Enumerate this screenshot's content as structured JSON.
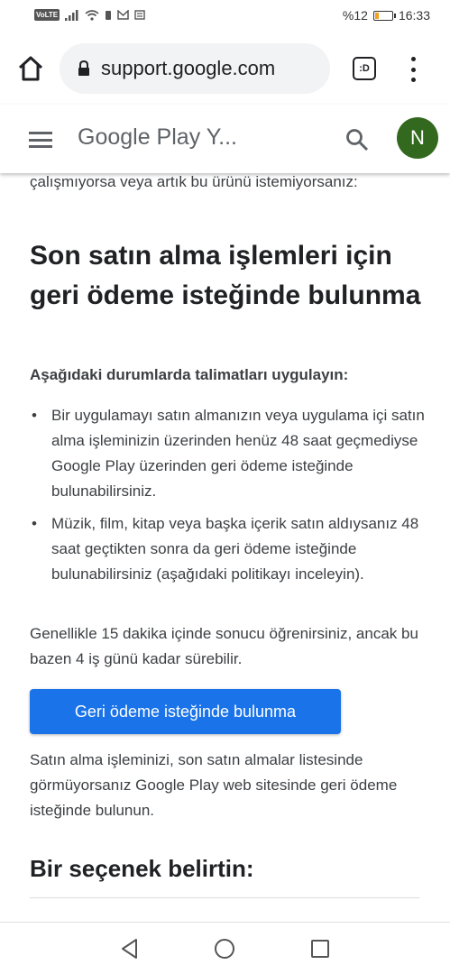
{
  "status_bar": {
    "volte": "VoLTE",
    "battery_text": "%12",
    "battery_level": 0.12,
    "time": "16:33"
  },
  "browser": {
    "url": "support.google.com",
    "tabs_label": ":D"
  },
  "site_header": {
    "title": "Google Play Y...",
    "avatar_initial": "N",
    "avatar_color": "#33691e"
  },
  "content": {
    "cut_line": "çalışmıyorsa veya artık bu ürünü istemiyorsanız:",
    "heading": "Son satın alma işlemleri için geri ödeme isteğinde bulunma",
    "subheading": "Aşağıdaki durumlarda talimatları uygulayın:",
    "bullets": [
      "Bir uygulamayı satın almanızın veya uygulama içi satın alma işleminizin üzerinden henüz 48 saat geçmediyse Google Play üzerinden geri ödeme isteğinde bulunabilirsiniz.",
      "Müzik, film, kitap veya başka içerik satın aldıysanız 48 saat geçtikten sonra da geri ödeme isteğinde bulunabilirsiniz (aşağıdaki politikayı inceleyin)."
    ],
    "paragraph_1": "Genellikle 15 dakika içinde sonucu öğrenirsiniz, ancak bu bazen 4 iş günü kadar sürebilir.",
    "cta_label": "Geri ödeme isteğinde bulunma",
    "cta_color": "#1a73e8",
    "paragraph_2": "Satın alma işleminizi, son satın almalar listesinde görmüyorsanız Google Play web sitesinde geri ödeme isteğinde bulunun.",
    "section_heading": "Bir seçenek belirtin:"
  }
}
